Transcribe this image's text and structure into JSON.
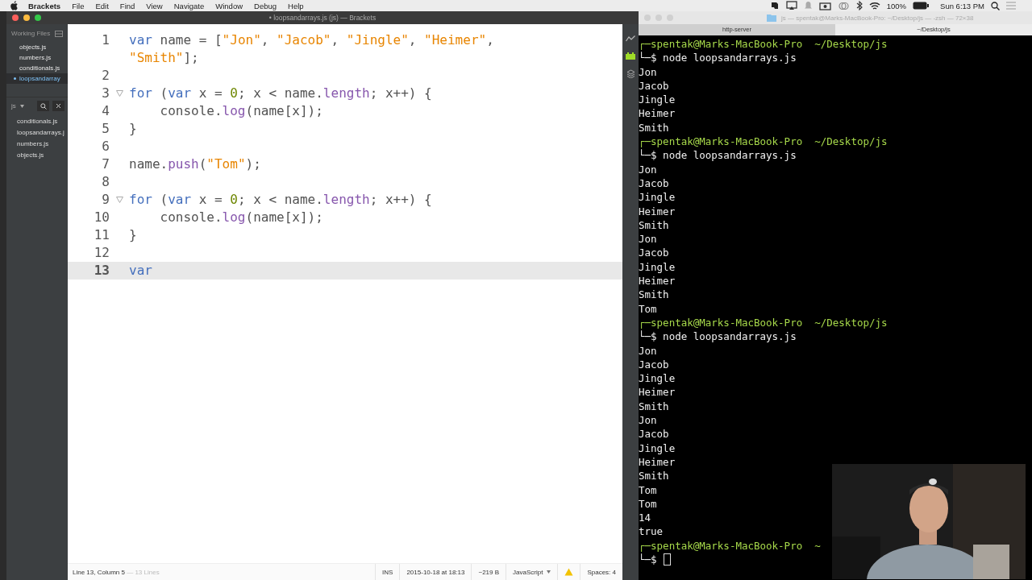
{
  "menu_bar": {
    "app": "Brackets",
    "items": [
      "File",
      "Edit",
      "Find",
      "View",
      "Navigate",
      "Window",
      "Debug",
      "Help"
    ],
    "battery": "100%",
    "clock": "Sun 6:13 PM"
  },
  "editor_window": {
    "title": "• loopsandarrays.js (js) — Brackets",
    "sidebar": {
      "working_files_title": "Working Files",
      "working_files": [
        {
          "label": "objects.js",
          "selected": false
        },
        {
          "label": "numbers.js",
          "selected": false
        },
        {
          "label": "conditionals.js",
          "selected": false
        },
        {
          "label": "loopsandarray",
          "selected": true
        }
      ],
      "project": "js",
      "project_files": [
        "conditionals.js",
        "loopsandarrays.j",
        "numbers.js",
        "objects.js"
      ]
    },
    "lines": [
      {
        "number": "1",
        "current": false,
        "foldable": false,
        "tokens": [
          {
            "t": "var",
            "kind": "keyword"
          },
          {
            "t": " name = [",
            "kind": "plain"
          },
          {
            "t": "\"Jon\"",
            "kind": "string"
          },
          {
            "t": ", ",
            "kind": "plain"
          },
          {
            "t": "\"Jacob\"",
            "kind": "string"
          },
          {
            "t": ", ",
            "kind": "plain"
          },
          {
            "t": "\"Jingle\"",
            "kind": "string"
          },
          {
            "t": ", ",
            "kind": "plain"
          },
          {
            "t": "\"Heimer\"",
            "kind": "string"
          },
          {
            "t": ", ",
            "kind": "plain"
          },
          {
            "t": "\"Smith\"",
            "kind": "string"
          },
          {
            "t": "];",
            "kind": "plain"
          }
        ]
      },
      {
        "number": "2",
        "current": false,
        "foldable": false
      },
      {
        "number": "3",
        "current": false,
        "foldable": true,
        "tokens": [
          {
            "t": "for",
            "kind": "keyword"
          },
          {
            "t": " (",
            "kind": "plain"
          },
          {
            "t": "var",
            "kind": "keyword"
          },
          {
            "t": " x = ",
            "kind": "plain"
          },
          {
            "t": "0",
            "kind": "number"
          },
          {
            "t": "; x < name.",
            "kind": "plain"
          },
          {
            "t": "length",
            "kind": "property"
          },
          {
            "t": "; x++) {",
            "kind": "plain"
          }
        ]
      },
      {
        "number": "4",
        "current": false,
        "foldable": false,
        "tokens": [
          {
            "t": "    console.",
            "kind": "plain"
          },
          {
            "t": "log",
            "kind": "property"
          },
          {
            "t": "(name[x]);",
            "kind": "plain"
          }
        ]
      },
      {
        "number": "5",
        "current": false,
        "foldable": false,
        "tokens": [
          {
            "t": "}",
            "kind": "plain"
          }
        ]
      },
      {
        "number": "6",
        "current": false,
        "foldable": false
      },
      {
        "number": "7",
        "current": false,
        "foldable": false,
        "tokens": [
          {
            "t": "name.",
            "kind": "plain"
          },
          {
            "t": "push",
            "kind": "property"
          },
          {
            "t": "(",
            "kind": "plain"
          },
          {
            "t": "\"Tom\"",
            "kind": "string"
          },
          {
            "t": ");",
            "kind": "plain"
          }
        ]
      },
      {
        "number": "8",
        "current": false,
        "foldable": false
      },
      {
        "number": "9",
        "current": false,
        "foldable": true,
        "tokens": [
          {
            "t": "for",
            "kind": "keyword"
          },
          {
            "t": " (",
            "kind": "plain"
          },
          {
            "t": "var",
            "kind": "keyword"
          },
          {
            "t": " x = ",
            "kind": "plain"
          },
          {
            "t": "0",
            "kind": "number"
          },
          {
            "t": "; x < name.",
            "kind": "plain"
          },
          {
            "t": "length",
            "kind": "property"
          },
          {
            "t": "; x++) {",
            "kind": "plain"
          }
        ]
      },
      {
        "number": "10",
        "current": false,
        "foldable": false,
        "tokens": [
          {
            "t": "    console.",
            "kind": "plain"
          },
          {
            "t": "log",
            "kind": "property"
          },
          {
            "t": "(name[x]);",
            "kind": "plain"
          }
        ]
      },
      {
        "number": "11",
        "current": false,
        "foldable": false,
        "tokens": [
          {
            "t": "}",
            "kind": "plain"
          }
        ]
      },
      {
        "number": "12",
        "current": false,
        "foldable": false
      },
      {
        "number": "13",
        "current": true,
        "foldable": false,
        "tokens": [
          {
            "t": "var",
            "kind": "keyword"
          }
        ]
      }
    ],
    "status_bar": {
      "position": "Line 13, Column 5",
      "lines_count": "— 13 Lines",
      "mode": "INS",
      "modified": "2015-10-18 at 18:13",
      "size": "~219 B",
      "language": "JavaScript",
      "spaces": "Spaces: 4"
    }
  },
  "terminal": {
    "title": "js — spentak@Marks-MacBook-Pro: ~/Desktop/js — -zsh — 72×38",
    "tabs": [
      {
        "label": "http-server",
        "selected": false
      },
      {
        "label": "~/Desktop/js",
        "selected": true
      }
    ],
    "lines": [
      {
        "kind": "prompt",
        "text": "┌─spentak@Marks-MacBook-Pro  ~/Desktop/js"
      },
      {
        "kind": "command",
        "text": "└─$ node loopsandarrays.js"
      },
      {
        "kind": "output",
        "text": "Jon"
      },
      {
        "kind": "output",
        "text": "Jacob"
      },
      {
        "kind": "output",
        "text": "Jingle"
      },
      {
        "kind": "output",
        "text": "Heimer"
      },
      {
        "kind": "output",
        "text": "Smith"
      },
      {
        "kind": "prompt",
        "text": "┌─spentak@Marks-MacBook-Pro  ~/Desktop/js"
      },
      {
        "kind": "command",
        "text": "└─$ node loopsandarrays.js"
      },
      {
        "kind": "output",
        "text": "Jon"
      },
      {
        "kind": "output",
        "text": "Jacob"
      },
      {
        "kind": "output",
        "text": "Jingle"
      },
      {
        "kind": "output",
        "text": "Heimer"
      },
      {
        "kind": "output",
        "text": "Smith"
      },
      {
        "kind": "output",
        "text": "Jon"
      },
      {
        "kind": "output",
        "text": "Jacob"
      },
      {
        "kind": "output",
        "text": "Jingle"
      },
      {
        "kind": "output",
        "text": "Heimer"
      },
      {
        "kind": "output",
        "text": "Smith"
      },
      {
        "kind": "output",
        "text": "Tom"
      },
      {
        "kind": "prompt",
        "text": "┌─spentak@Marks-MacBook-Pro  ~/Desktop/js"
      },
      {
        "kind": "command",
        "text": "└─$ node loopsandarrays.js"
      },
      {
        "kind": "output",
        "text": "Jon"
      },
      {
        "kind": "output",
        "text": "Jacob"
      },
      {
        "kind": "output",
        "text": "Jingle"
      },
      {
        "kind": "output",
        "text": "Heimer"
      },
      {
        "kind": "output",
        "text": "Smith"
      },
      {
        "kind": "output",
        "text": "Jon"
      },
      {
        "kind": "output",
        "text": "Jacob"
      },
      {
        "kind": "output",
        "text": "Jingle"
      },
      {
        "kind": "output",
        "text": "Heimer"
      },
      {
        "kind": "output",
        "text": "Smith"
      },
      {
        "kind": "output",
        "text": "Tom"
      },
      {
        "kind": "output",
        "text": "Tom"
      },
      {
        "kind": "output",
        "text": "14"
      },
      {
        "kind": "output",
        "text": "true"
      },
      {
        "kind": "prompt",
        "text": "┌─spentak@Marks-MacBook-Pro  ~"
      },
      {
        "kind": "command",
        "text": "└─$"
      }
    ]
  }
}
